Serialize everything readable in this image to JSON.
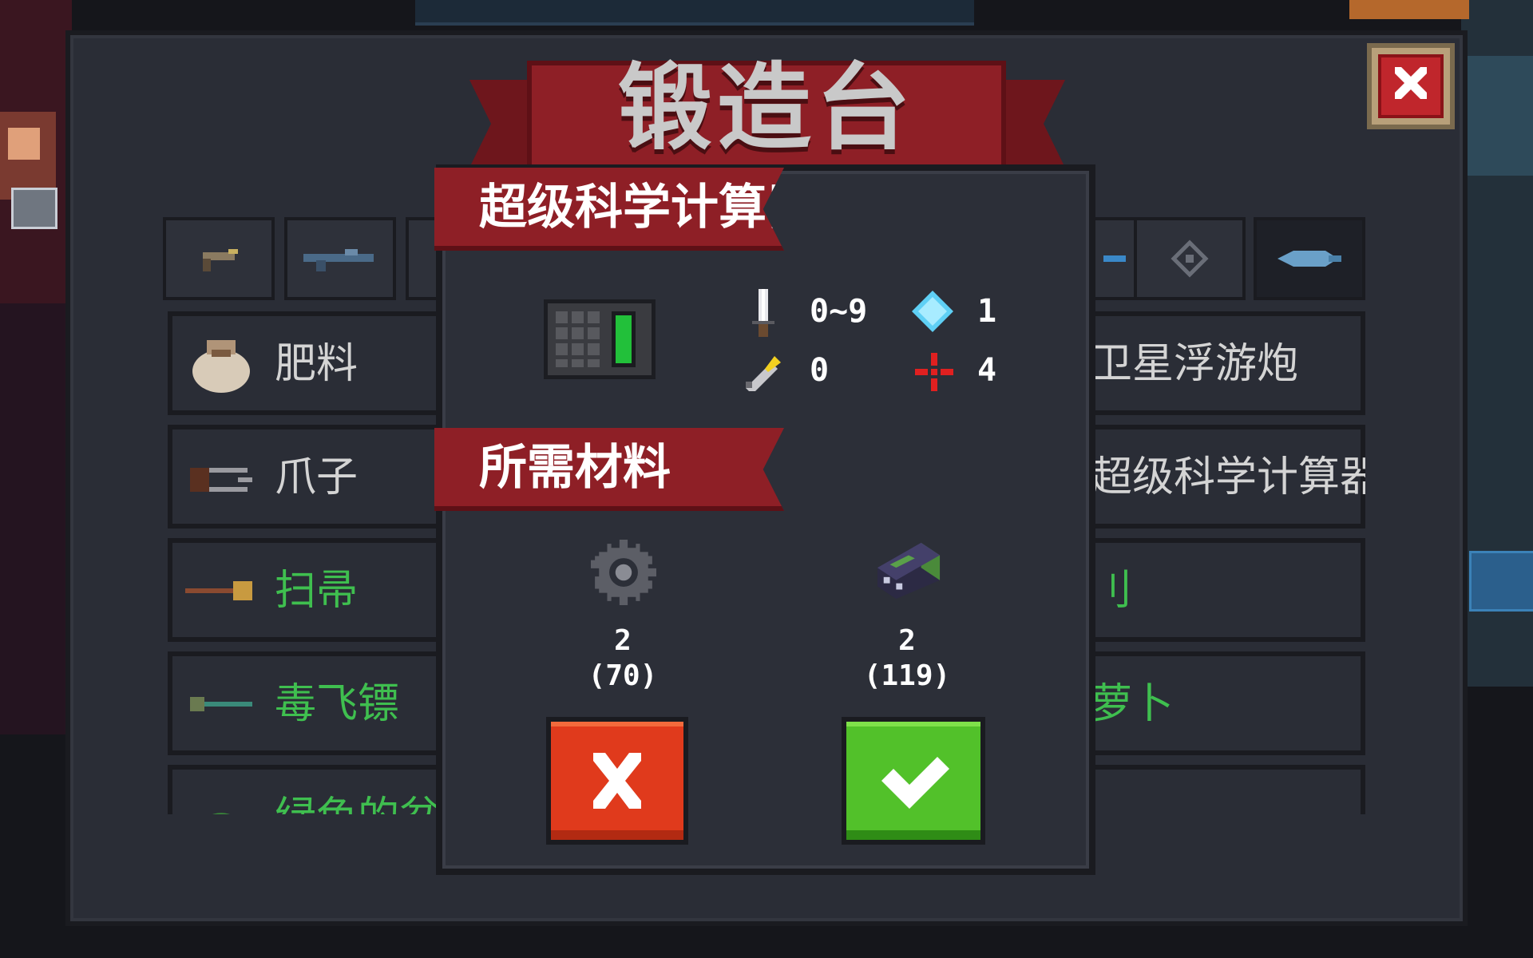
{
  "window": {
    "title": "锻造台",
    "close_icon": "close-x-icon"
  },
  "tabs": [
    {
      "icon": "pistol-icon"
    },
    {
      "icon": "rifle-icon"
    },
    {
      "icon": "shotgun-icon"
    },
    {
      "icon": "blaster-icon"
    },
    {
      "icon": "crosshair-icon"
    },
    {
      "icon": "fish-gun-icon",
      "active": true
    }
  ],
  "list": {
    "left": [
      {
        "name": "肥料",
        "icon": "sack-icon",
        "color": "#d4d4d4"
      },
      {
        "name": "爪子",
        "icon": "claw-icon",
        "color": "#d4d4d4"
      },
      {
        "name": "扫帚",
        "icon": "broom-icon",
        "color": "#3fbf4f"
      },
      {
        "name": "毒飞镖",
        "icon": "dart-icon",
        "color": "#3fbf4f"
      },
      {
        "name": "绿色的盆",
        "icon": "green-pot-icon",
        "color": "#3fbf4f"
      }
    ],
    "right": [
      {
        "name": "卫星浮游炮",
        "color": "#d4d4d4"
      },
      {
        "name": "超级科学计算器",
        "color": "#d4d4d4"
      },
      {
        "name": "刂",
        "color": "#3fbf4f"
      },
      {
        "name": "萝卜",
        "color": "#3fbf4f"
      },
      {
        "name": "",
        "color": "#3fbf4f"
      }
    ]
  },
  "dialog": {
    "item_name": "超级科学计算器",
    "item_icon": "calculator-icon",
    "stats": {
      "damage": "0~9",
      "energy": "1",
      "crit": "0",
      "accuracy": "4"
    },
    "materials_title": "所需材料",
    "materials": [
      {
        "icon": "gear-icon",
        "required": "2",
        "owned": "(70)"
      },
      {
        "icon": "battery-part-icon",
        "required": "2",
        "owned": "(119)"
      }
    ],
    "cancel_icon": "cancel-x-icon",
    "confirm_icon": "checkmark-icon"
  },
  "colors": {
    "banner": "#8e1f26",
    "cancel": "#e03a1c",
    "confirm": "#52c12a",
    "rarity_green": "#3fbf4f"
  }
}
